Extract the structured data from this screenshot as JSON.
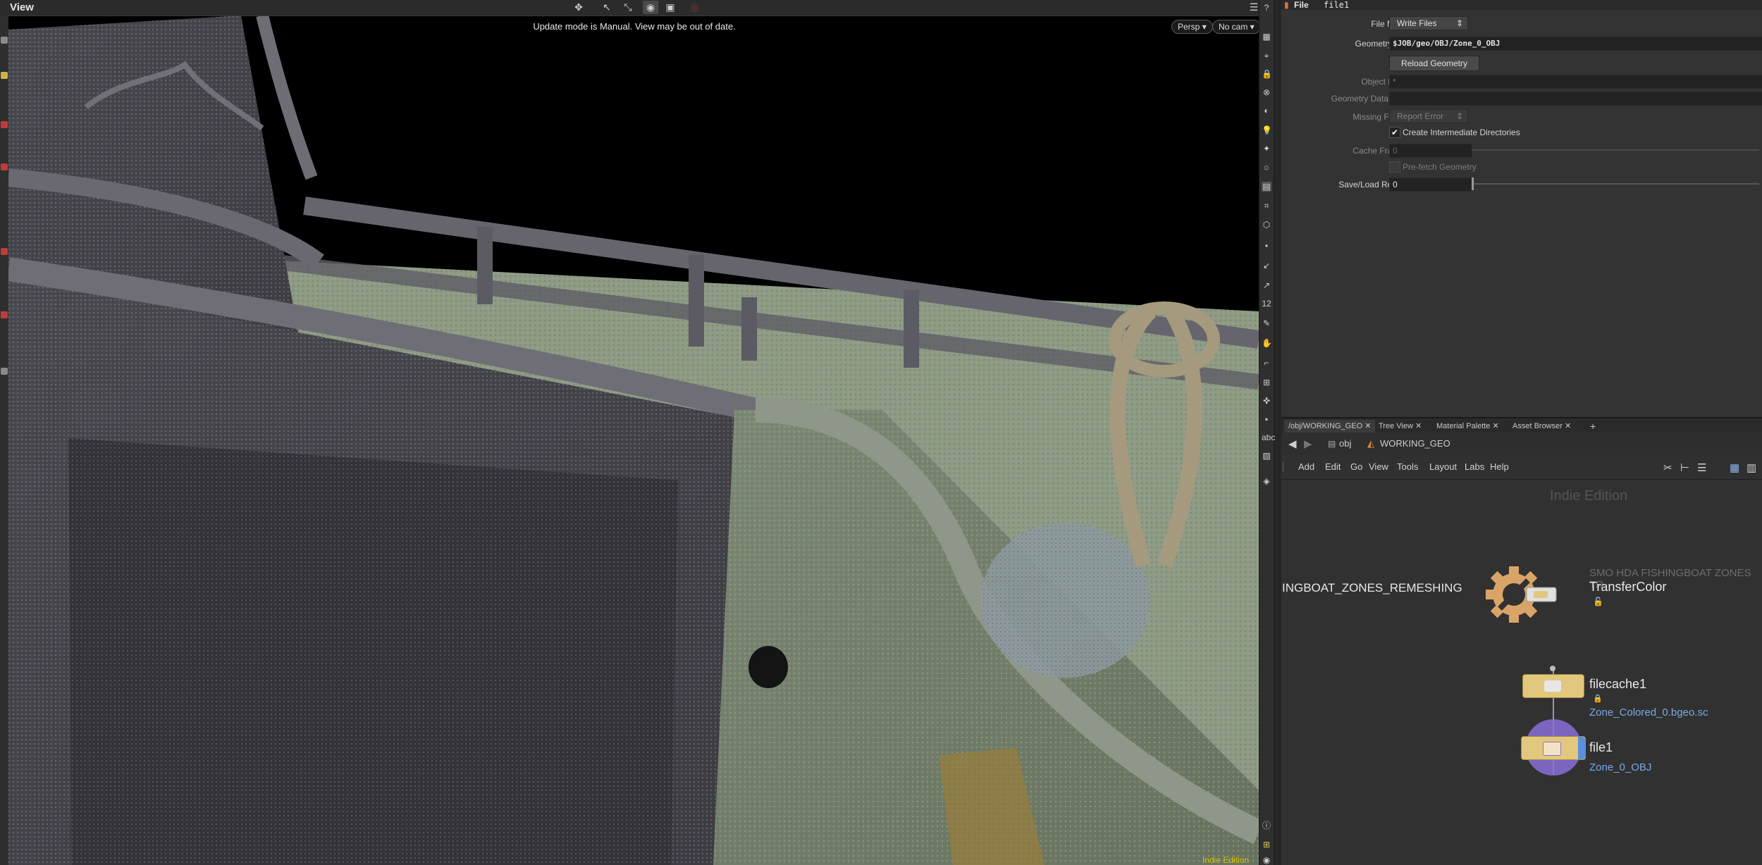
{
  "viewport": {
    "title": "View",
    "message": "Update mode is Manual. View may be out of date.",
    "persp_label": "Persp",
    "cam_label": "No cam",
    "footer": "Indie Edition"
  },
  "params": {
    "node_type": "File",
    "node_name": "file1",
    "file_mode": {
      "label": "File Mode",
      "value": "Write Files"
    },
    "geometry_file": {
      "label": "Geometry File",
      "value": "$JOB/geo/OBJ/Zone_0_OBJ"
    },
    "reload_label": "Reload Geometry",
    "object_mask": {
      "label": "Object Mask",
      "value": "*"
    },
    "geometry_data_path": {
      "label": "Geometry Data Path"
    },
    "missing_frame": {
      "label": "Missing Frame",
      "value": "Report Error"
    },
    "create_dirs": {
      "label": "Create Intermediate Directories",
      "checked": true
    },
    "cache_frames": {
      "label": "Cache Frames",
      "value": "0"
    },
    "prefetch": {
      "label": "Pre-fetch Geometry",
      "checked": false
    },
    "retries": {
      "label": "Save/Load Retries",
      "value": "0"
    }
  },
  "network": {
    "tabs": [
      {
        "label": "/obj/WORKING_GEO",
        "active": true
      },
      {
        "label": "Tree View"
      },
      {
        "label": "Material Palette"
      },
      {
        "label": "Asset Browser"
      }
    ],
    "path": [
      "obj",
      "WORKING_GEO"
    ],
    "menu": [
      "Add",
      "Edit",
      "Go",
      "View",
      "Tools",
      "Layout",
      "Labs",
      "Help"
    ],
    "watermark": "Indie Edition",
    "left_label": "INGBOAT_ZONES_REMESHING",
    "nodes": {
      "transfer": {
        "type": "SMO HDA FISHINGBOAT ZONES TR",
        "name": "TransferColor"
      },
      "filecache": {
        "name": "filecache1",
        "sub": "Zone_Colored_0.bgeo.sc"
      },
      "file": {
        "name": "file1",
        "sub": "Zone_0_OBJ"
      }
    }
  },
  "colors": {
    "node_yellow": "#e2c77e",
    "gear_orange": "#d9a468",
    "display_blue": "#5a8fe0",
    "template_purple": "#8a6fd8",
    "link_blue": "#7aa8e6"
  }
}
